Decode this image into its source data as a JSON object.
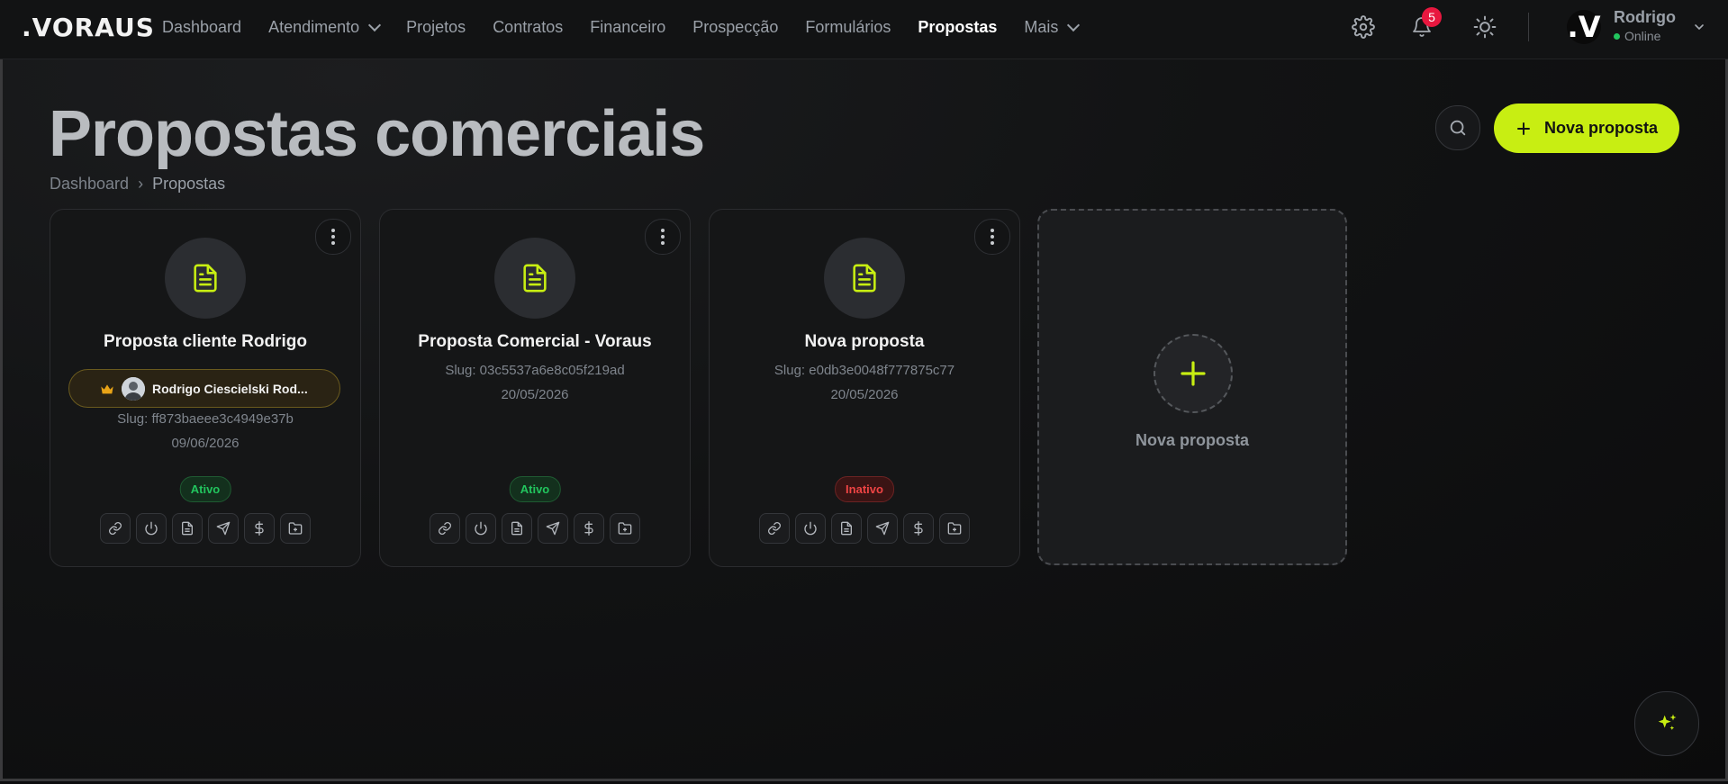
{
  "app": {
    "logo": ".VORAUS"
  },
  "nav": {
    "items": [
      {
        "label": "Dashboard",
        "dropdown": false,
        "active": false
      },
      {
        "label": "Atendimento",
        "dropdown": true,
        "active": false
      },
      {
        "label": "Projetos",
        "dropdown": false,
        "active": false
      },
      {
        "label": "Contratos",
        "dropdown": false,
        "active": false
      },
      {
        "label": "Financeiro",
        "dropdown": false,
        "active": false
      },
      {
        "label": "Prospecção",
        "dropdown": false,
        "active": false
      },
      {
        "label": "Formulários",
        "dropdown": false,
        "active": false
      },
      {
        "label": "Propostas",
        "dropdown": false,
        "active": true
      },
      {
        "label": "Mais",
        "dropdown": true,
        "active": false
      }
    ],
    "notifications_count": "5",
    "user": {
      "avatar_letter": ".V",
      "name": "Rodrigo",
      "status": "Online"
    }
  },
  "header": {
    "title": "Propostas comerciais",
    "breadcrumb": [
      "Dashboard",
      "Propostas"
    ],
    "breadcrumb_sep": "›",
    "new_button": "Nova proposta"
  },
  "cards": [
    {
      "title": "Proposta cliente Rodrigo",
      "owner": "Rodrigo Ciescielski Rod...",
      "slug": "Slug: ff873baeee3c4949e37b",
      "date": "09/06/2026",
      "status": "Ativo",
      "status_active": true
    },
    {
      "title": "Proposta Comercial - Voraus",
      "slug": "Slug: 03c5537a6e8c05f219ad",
      "date": "20/05/2026",
      "status": "Ativo",
      "status_active": true
    },
    {
      "title": "Nova proposta",
      "slug": "Slug: e0db3e0048f777875c77",
      "date": "20/05/2026",
      "status": "Inativo",
      "status_active": false
    }
  ],
  "add_card": {
    "label": "Nova proposta"
  },
  "card_actions": [
    "link-icon",
    "power-icon",
    "file-icon",
    "send-icon",
    "dollar-icon",
    "folder-icon"
  ],
  "colors": {
    "accent": "#c8ee12",
    "active": "#22c55e",
    "inactive": "#ef4444",
    "badge": "#e8173f"
  }
}
